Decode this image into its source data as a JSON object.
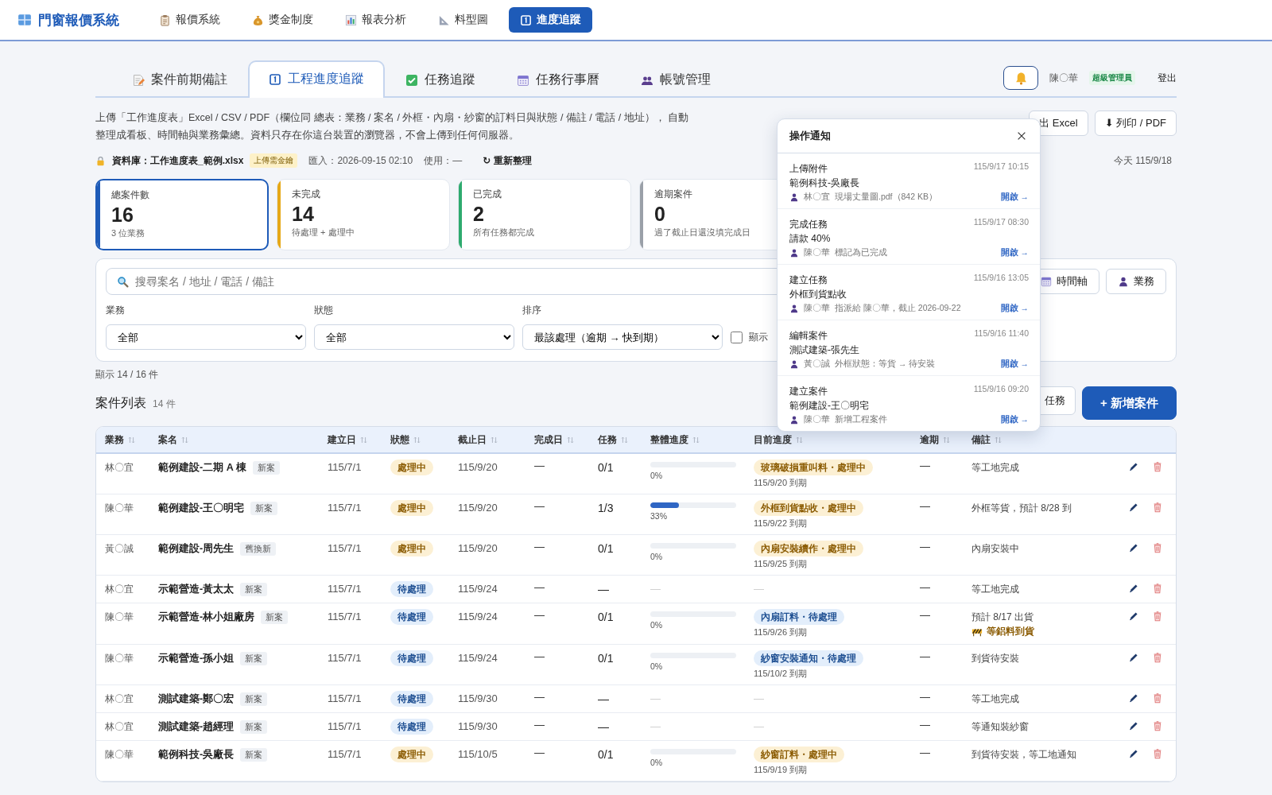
{
  "app": {
    "title": "門窗報價系統"
  },
  "nav": [
    {
      "label": "報價系統",
      "selected": false
    },
    {
      "label": "獎金制度",
      "selected": false
    },
    {
      "label": "報表分析",
      "selected": false
    },
    {
      "label": "料型圖",
      "selected": false
    },
    {
      "label": "進度追蹤",
      "selected": true
    }
  ],
  "tabs": [
    {
      "label": "案件前期備註",
      "selected": false
    },
    {
      "label": "工程進度追蹤",
      "selected": true
    },
    {
      "label": "任務追蹤",
      "selected": false
    },
    {
      "label": "任務行事曆",
      "selected": false
    },
    {
      "label": "帳號管理",
      "selected": false
    }
  ],
  "user": {
    "name": "陳〇華",
    "role": "超級管理員",
    "logout": "登出"
  },
  "description": "上傳「工作進度表」Excel / CSV / PDF（欄位同 總表：業務 / 案名 / 外框・內扇・紗窗的訂料日與狀態 / 備註 / 電話 / 地址）， 自動整理成看板、時間軸與業務彙總。資料只存在你這台裝置的瀏覽器，不會上傳到任何伺服器。",
  "export_buttons": [
    "出 Excel",
    "⬇ 列印 / PDF"
  ],
  "database": {
    "label": "資料庫：工作進度表_範例.xlsx",
    "badge": "上傳需金鑰",
    "imported": "匯入：2026-09-15 02:10",
    "usage": "使用：—",
    "refresh": "↻ 重新整理"
  },
  "today": "今天 115/9/18",
  "stats": [
    {
      "label": "總案件數",
      "value": "16",
      "sub": "3 位業務",
      "color": "#1e5bb8",
      "selected": true
    },
    {
      "label": "未完成",
      "value": "14",
      "sub": "待處理 + 處理中",
      "color": "#e6a817",
      "selected": false
    },
    {
      "label": "已完成",
      "value": "2",
      "sub": "所有任務都完成",
      "color": "#2eaa6e",
      "selected": false
    },
    {
      "label": "逾期案件",
      "value": "0",
      "sub": "過了截止日還沒填完成日",
      "color": "#9aa0a8",
      "selected": false
    }
  ],
  "filters": {
    "search_placeholder": "搜尋案名 / 地址 / 電話 / 備註",
    "view_buttons": [
      "時間軸",
      "業務"
    ],
    "selects": [
      {
        "label": "業務",
        "value": "全部"
      },
      {
        "label": "狀態",
        "value": "全部"
      },
      {
        "label": "排序",
        "value": "最該處理（逾期 → 快到期）"
      }
    ],
    "checkbox": {
      "label": "顯示",
      "checked": false
    }
  },
  "count": "顯示 14 / 16 件",
  "list": {
    "title": "案件列表",
    "count": "14 件",
    "buttons": [
      {
        "label": "任務",
        "kind": "secondary"
      },
      {
        "label": "+ 新增案件",
        "kind": "primary"
      }
    ]
  },
  "table": {
    "columns": [
      "業務",
      "案名",
      "建立日",
      "狀態",
      "截止日",
      "完成日",
      "任務",
      "整體進度",
      "目前進度",
      "逾期",
      "備註"
    ],
    "rows": [
      {
        "sales": "林〇宜",
        "name": "範例建設-二期 A 棟",
        "tag": "新案",
        "created": "115/7/1",
        "status": {
          "text": "處理中",
          "kind": "active"
        },
        "deadline": "115/9/20",
        "done": "—",
        "tasks": "0/1",
        "progress": {
          "level": 0,
          "label": "0%"
        },
        "current": {
          "text": "玻璃破損重叫料・處理中",
          "kind": "active",
          "due": "115/9/20 到期"
        },
        "overdue": "—",
        "note": "等工地完成"
      },
      {
        "sales": "陳〇華",
        "name": "範例建設-王〇明宅",
        "tag": "新案",
        "created": "115/7/1",
        "status": {
          "text": "處理中",
          "kind": "active"
        },
        "deadline": "115/9/20",
        "done": "—",
        "tasks": "1/3",
        "progress": {
          "level": 0.33,
          "label": "33%"
        },
        "current": {
          "text": "外框到貨點收・處理中",
          "kind": "active",
          "due": "115/9/22 到期"
        },
        "overdue": "—",
        "note": "外框等貨，預計 8/28 到"
      },
      {
        "sales": "黃〇誠",
        "name": "範例建設-周先生",
        "tag": "舊換新",
        "created": "115/7/1",
        "status": {
          "text": "處理中",
          "kind": "active"
        },
        "deadline": "115/9/20",
        "done": "—",
        "tasks": "0/1",
        "progress": {
          "level": 0,
          "label": "0%"
        },
        "current": {
          "text": "內扇安裝續作・處理中",
          "kind": "active",
          "due": "115/9/25 到期"
        },
        "overdue": "—",
        "note": "內扇安裝中"
      },
      {
        "sales": "林〇宜",
        "name": "示範營造-黃太太",
        "tag": "新案",
        "created": "115/7/1",
        "status": {
          "text": "待處理",
          "kind": "pending"
        },
        "deadline": "115/9/24",
        "done": "—",
        "tasks": "—",
        "progress_none": "—",
        "current_none": "—",
        "overdue": "—",
        "note": "等工地完成"
      },
      {
        "sales": "陳〇華",
        "name": "示範營造-林小姐廠房",
        "tag": "新案",
        "created": "115/7/1",
        "status": {
          "text": "待處理",
          "kind": "pending"
        },
        "deadline": "115/9/24",
        "done": "—",
        "tasks": "0/1",
        "progress": {
          "level": 0,
          "label": "0%"
        },
        "current": {
          "text": "內扇訂料・待處理",
          "kind": "pending",
          "due": "115/9/26 到期"
        },
        "overdue": "—",
        "note": "預計 8/17 出貨",
        "flag": "等鋁料到貨"
      },
      {
        "sales": "陳〇華",
        "name": "示範營造-孫小姐",
        "tag": "新案",
        "created": "115/7/1",
        "status": {
          "text": "待處理",
          "kind": "pending"
        },
        "deadline": "115/9/24",
        "done": "—",
        "tasks": "0/1",
        "progress": {
          "level": 0,
          "label": "0%"
        },
        "current": {
          "text": "紗窗安裝通知・待處理",
          "kind": "pending",
          "due": "115/10/2 到期"
        },
        "overdue": "—",
        "note": "到貨待安裝"
      },
      {
        "sales": "林〇宜",
        "name": "測試建築-鄭〇宏",
        "tag": "新案",
        "created": "115/7/1",
        "status": {
          "text": "待處理",
          "kind": "pending"
        },
        "deadline": "115/9/30",
        "done": "—",
        "tasks": "—",
        "progress_none": "—",
        "current_none": "—",
        "overdue": "—",
        "note": "等工地完成"
      },
      {
        "sales": "林〇宜",
        "name": "測試建築-趙經理",
        "tag": "新案",
        "created": "115/7/1",
        "status": {
          "text": "待處理",
          "kind": "pending"
        },
        "deadline": "115/9/30",
        "done": "—",
        "tasks": "—",
        "progress_none": "—",
        "current_none": "—",
        "overdue": "—",
        "note": "等通知裝紗窗"
      },
      {
        "sales": "陳〇華",
        "name": "範例科技-吳廠長",
        "tag": "新案",
        "created": "115/7/1",
        "status": {
          "text": "處理中",
          "kind": "active"
        },
        "deadline": "115/10/5",
        "done": "—",
        "tasks": "0/1",
        "progress": {
          "level": 0,
          "label": "0%"
        },
        "current": {
          "text": "紗窗訂料・處理中",
          "kind": "active",
          "due": "115/9/19 到期"
        },
        "overdue": "—",
        "note": "到貨待安裝，等工地通知"
      }
    ]
  },
  "notifications": {
    "title": "操作通知",
    "items": [
      {
        "action": "上傳附件",
        "time": "115/9/17 10:15",
        "target": "範例科技-吳廠長",
        "user": "林〇宜",
        "detail": "現場丈量圖.pdf（842 KB）",
        "link": "開啟 →"
      },
      {
        "action": "完成任務",
        "time": "115/9/17 08:30",
        "target": "請款 40%",
        "user": "陳〇華",
        "detail": "標記為已完成",
        "link": "開啟 →"
      },
      {
        "action": "建立任務",
        "time": "115/9/16 13:05",
        "target": "外框到貨點收",
        "user": "陳〇華",
        "detail": "指派給 陳〇華，截止 2026-09-22",
        "link": "開啟 →"
      },
      {
        "action": "編輯案件",
        "time": "115/9/16 11:40",
        "target": "測試建築-張先生",
        "user": "黃〇誠",
        "detail": "外框狀態：等貨 → 待安裝",
        "link": "開啟 →"
      },
      {
        "action": "建立案件",
        "time": "115/9/16 09:20",
        "target": "範例建設-王〇明宅",
        "user": "陳〇華",
        "detail": "新增工程案件",
        "link": "開啟 →"
      }
    ]
  }
}
